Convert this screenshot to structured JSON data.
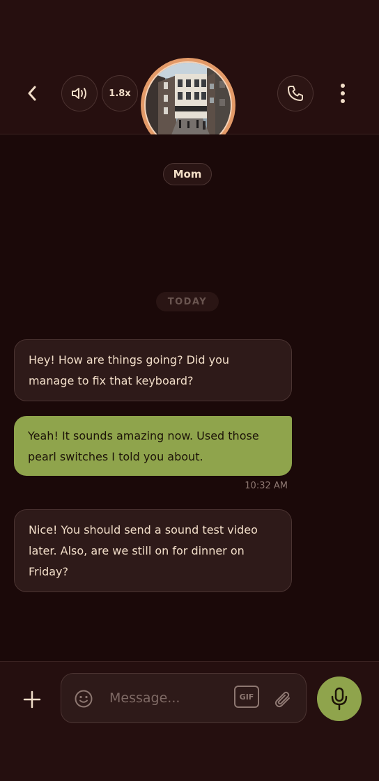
{
  "header": {
    "back_icon": "chevron-left-icon",
    "sound_icon": "speaker-icon",
    "speed_label": "1.8x",
    "call_icon": "phone-icon",
    "more_icon": "more-vertical-icon"
  },
  "contact": {
    "name": "Mom"
  },
  "chat": {
    "date_label": "TODAY",
    "messages": [
      {
        "direction": "incoming",
        "text": "Hey! How are things going? Did you manage to fix that keyboard?"
      },
      {
        "direction": "outgoing",
        "text": "Yeah! It sounds amazing now. Used those pearl switches I told you about.",
        "time": "10:32 AM"
      },
      {
        "direction": "incoming",
        "text": "Nice! You should send a sound test video later. Also, are we still on for dinner on Friday?"
      }
    ]
  },
  "composer": {
    "add_icon": "plus-icon",
    "emoji_icon": "emoji-icon",
    "placeholder": "Message...",
    "gif_label": "GIF",
    "attach_icon": "paperclip-icon",
    "mic_icon": "microphone-icon"
  },
  "colors": {
    "background": "#230f0e",
    "accent": "#8fa44c",
    "avatar_ring": "#e39a68"
  }
}
